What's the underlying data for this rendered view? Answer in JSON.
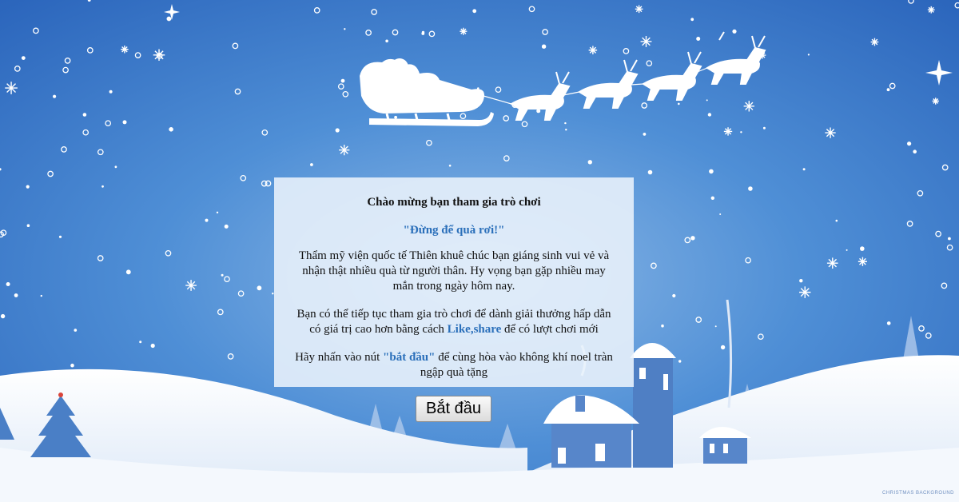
{
  "welcome": {
    "title": "Chào mừng bạn tham gia trò chơi",
    "subtitle": "\"Đừng để quà rơi!\"",
    "paragraph1": "Thẩm mỹ viện quốc tế Thiên khuê chúc bạn giáng sinh vui vẻ và nhận thật nhiều quà từ người thân. Hy vọng bạn gặp nhiều may mắn trong ngày hôm nay.",
    "paragraph2_before": "Bạn có thể tiếp tục tham gia trò chơi để dành giải thưởng hấp dẫn có giá trị cao hơn bằng cách ",
    "paragraph2_highlight": "Like,share",
    "paragraph2_after": " để có lượt chơi mới",
    "paragraph3_before": "Hãy nhấn vào nút ",
    "paragraph3_highlight": "\"bắt đầu\"",
    "paragraph3_after": " để cùng hòa vào không khí noel tràn ngập quà tặng"
  },
  "start_button": {
    "label": "Bắt đầu"
  },
  "background": {
    "credit_text": "CHRISTMAS BACKGROUND"
  },
  "colors": {
    "sky_top": "#2f6fc4",
    "sky_bottom": "#8cb8e6",
    "accent_text": "#2a6fba",
    "snow": "#ffffff"
  }
}
